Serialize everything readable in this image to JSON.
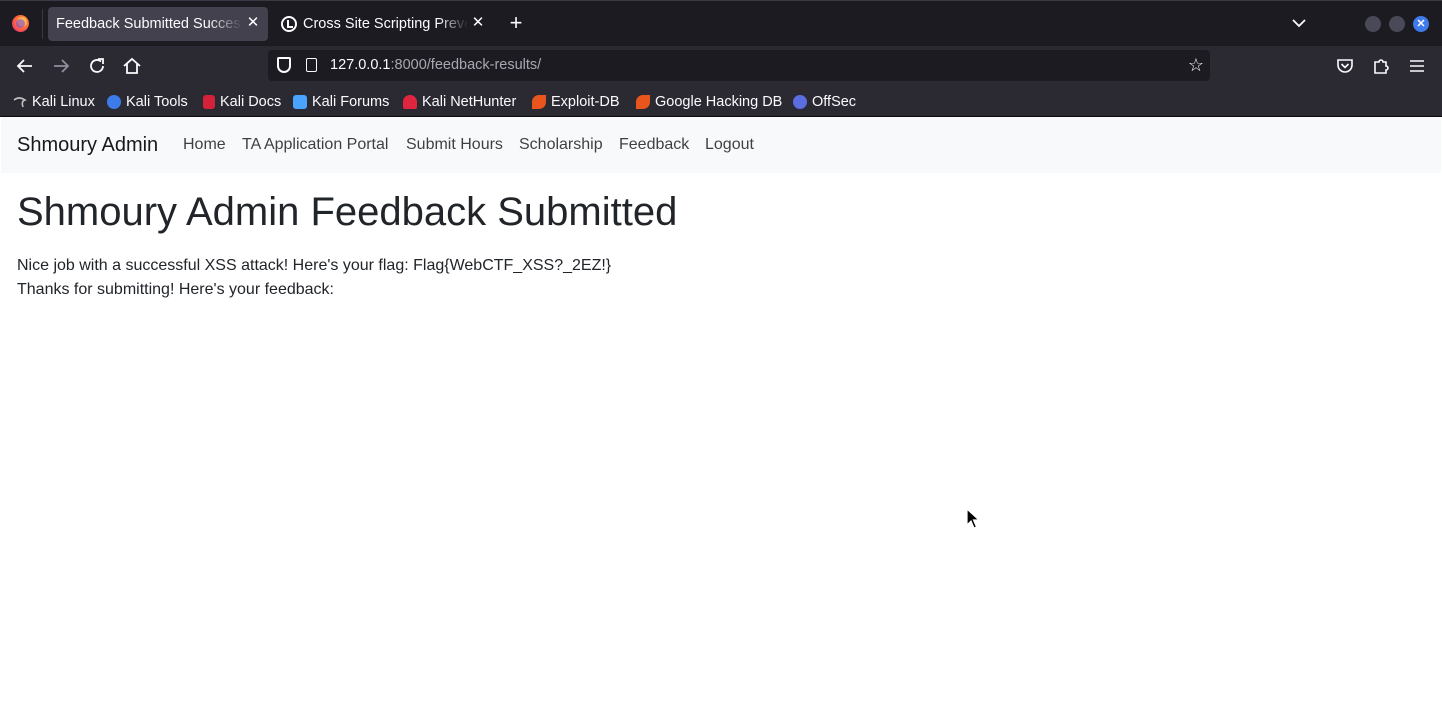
{
  "browser": {
    "tabs": [
      {
        "title": "Feedback Submitted Successfully",
        "active": true
      },
      {
        "title": "Cross Site Scripting Prevention",
        "active": false
      }
    ],
    "url": {
      "host": "127.0.0.1",
      "rest": ":8000/feedback-results/"
    },
    "bookmarks": [
      {
        "label": "Kali Linux",
        "color": "#c0c0c0"
      },
      {
        "label": "Kali Tools",
        "color": "#3d7bea"
      },
      {
        "label": "Kali Docs",
        "color": "#d6213a"
      },
      {
        "label": "Kali Forums",
        "color": "#4aa3ff"
      },
      {
        "label": "Kali NetHunter",
        "color": "#e0263f"
      },
      {
        "label": "Exploit-DB",
        "color": "#e8561d"
      },
      {
        "label": "Google Hacking DB",
        "color": "#e8561d"
      },
      {
        "label": "OffSec",
        "color": "#5b6ee1"
      }
    ]
  },
  "site": {
    "brand": "Shmoury Admin",
    "nav": [
      "Home",
      "TA Application Portal",
      "Submit Hours",
      "Scholarship",
      "Feedback",
      "Logout"
    ]
  },
  "page": {
    "title": "Shmoury Admin Feedback Submitted",
    "flag_message": "Nice job with a successful XSS attack! Here's your flag: Flag{WebCTF_XSS?_2EZ!}",
    "thanks_message": "Thanks for submitting! Here's your feedback:"
  }
}
